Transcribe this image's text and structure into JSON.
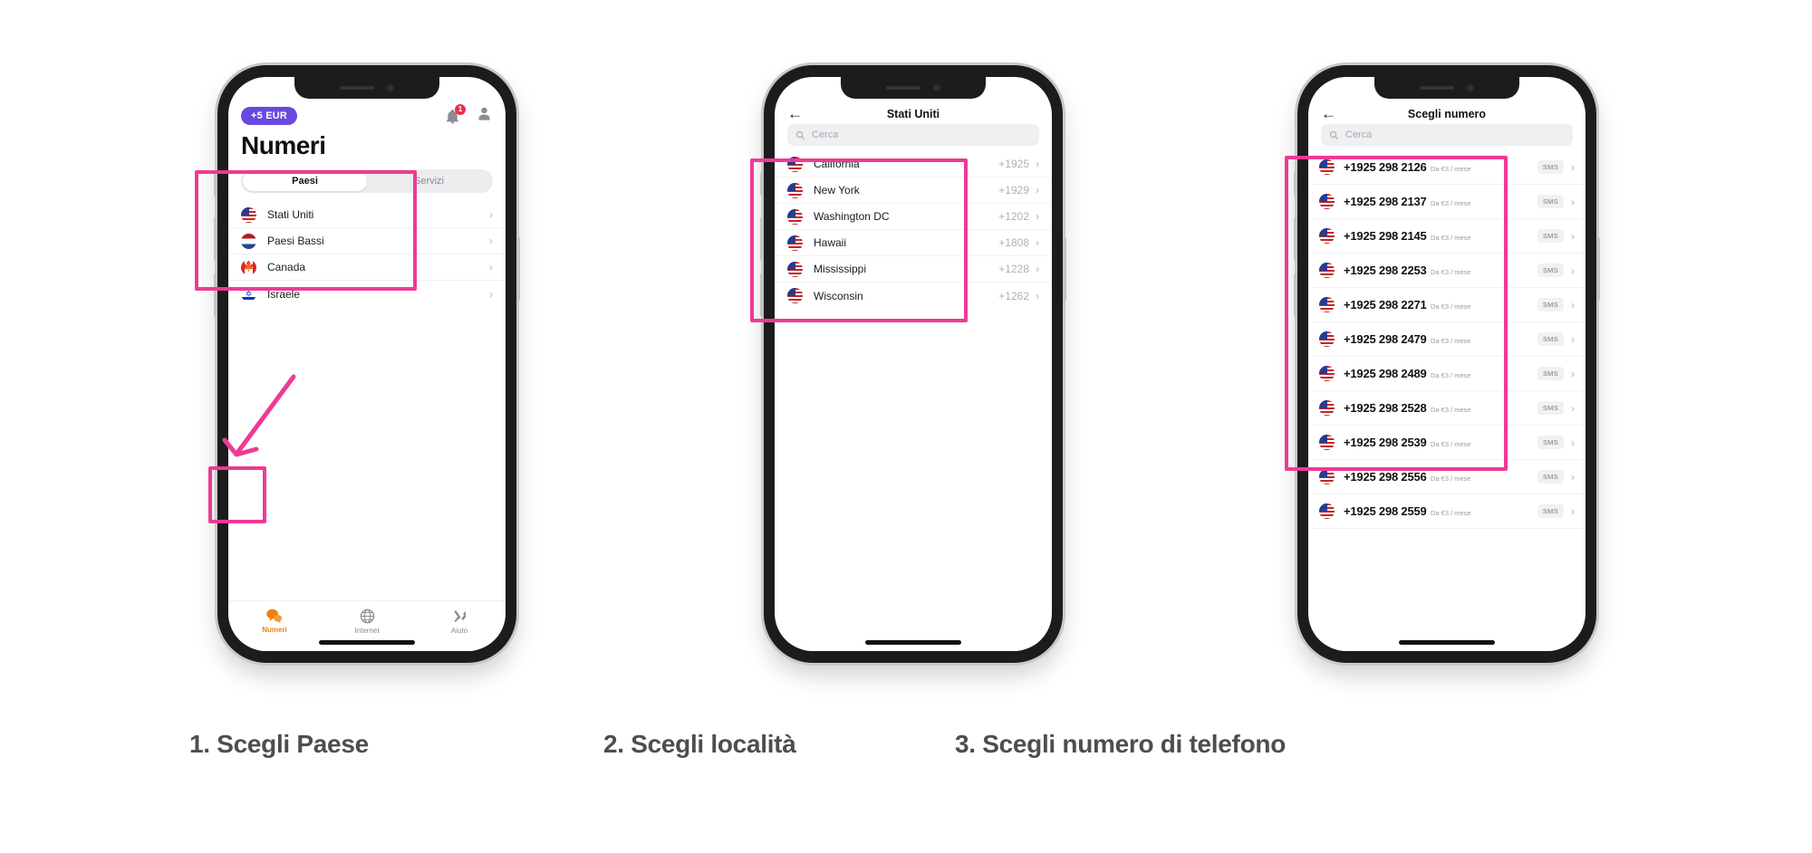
{
  "screen1": {
    "balance_badge": "+5 EUR",
    "bell_badge": "1",
    "title": "Numeri",
    "tabs": [
      {
        "label": "Paesi",
        "active": true
      },
      {
        "label": "Servizi",
        "active": false
      }
    ],
    "countries": [
      {
        "name": "Stati Uniti",
        "flag": "us"
      },
      {
        "name": "Paesi Bassi",
        "flag": "nl"
      },
      {
        "name": "Canada",
        "flag": "ca"
      },
      {
        "name": "Israele",
        "flag": "il"
      }
    ],
    "tabbar": [
      {
        "label": "Numeri",
        "icon": "chat-bubbles-icon",
        "active": true
      },
      {
        "label": "Internet",
        "icon": "globe-icon",
        "active": false
      },
      {
        "label": "Aiuto",
        "icon": "tools-icon",
        "active": false
      }
    ]
  },
  "screen2": {
    "nav_title": "Stati Uniti",
    "search_placeholder": "Cerca",
    "locations": [
      {
        "name": "California",
        "code": "+1925"
      },
      {
        "name": "New York",
        "code": "+1929"
      },
      {
        "name": "Washington DC",
        "code": "+1202"
      },
      {
        "name": "Hawaii",
        "code": "+1808"
      },
      {
        "name": "Mississippi",
        "code": "+1228"
      },
      {
        "name": "Wisconsin",
        "code": "+1262"
      }
    ]
  },
  "screen3": {
    "nav_title": "Scegli numero",
    "search_placeholder": "Cerca",
    "numbers": [
      {
        "number": "+1925 298 2126",
        "price": "Da €3 / mese",
        "tag": "SMS"
      },
      {
        "number": "+1925 298 2137",
        "price": "Da €3 / mese",
        "tag": "SMS"
      },
      {
        "number": "+1925 298 2145",
        "price": "Da €3 / mese",
        "tag": "SMS"
      },
      {
        "number": "+1925 298 2253",
        "price": "Da €3 / mese",
        "tag": "SMS"
      },
      {
        "number": "+1925 298 2271",
        "price": "Da €3 / mese",
        "tag": "SMS"
      },
      {
        "number": "+1925 298 2479",
        "price": "Da €3 / mese",
        "tag": "SMS"
      },
      {
        "number": "+1925 298 2489",
        "price": "Da €3 / mese",
        "tag": "SMS"
      },
      {
        "number": "+1925 298 2528",
        "price": "Da €3 / mese",
        "tag": "SMS"
      },
      {
        "number": "+1925 298 2539",
        "price": "Da €3 / mese",
        "tag": "SMS"
      },
      {
        "number": "+1925 298 2556",
        "price": "Da €3 / mese",
        "tag": "SMS"
      },
      {
        "number": "+1925 298 2559",
        "price": "Da €3 / mese",
        "tag": "SMS"
      }
    ]
  },
  "captions": [
    "1. Scegli Paese",
    "2. Scegli località",
    "3. Scegli numero di telefono"
  ],
  "colors": {
    "highlight_pink": "#ef3a94",
    "badge_purple": "#6a49e0",
    "notification_red": "#e8304a",
    "active_tab_orange": "#f08012",
    "caption_gray": "#4e4e4e"
  }
}
